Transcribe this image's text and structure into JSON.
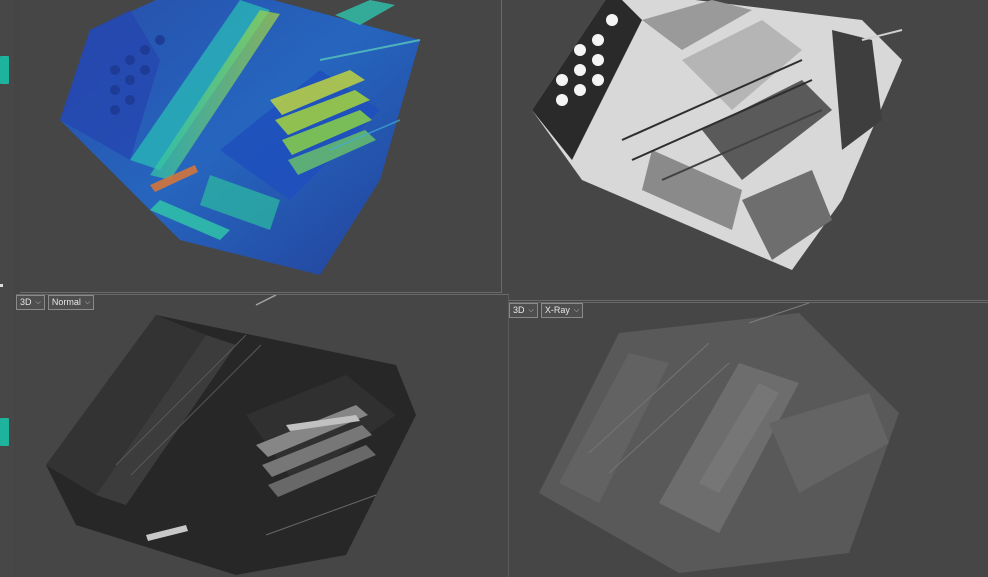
{
  "viewports": [
    {
      "id": "top-left",
      "render": "color-gradient"
    },
    {
      "id": "top-right",
      "render": "grayscale-shaded"
    },
    {
      "id": "bottom-left",
      "view_label": "3D",
      "mode_label": "Normal",
      "render": "dark-normal"
    },
    {
      "id": "bottom-right",
      "view_label": "3D",
      "mode_label": "X-Ray",
      "render": "xray"
    }
  ],
  "colors": {
    "accent": "#1db39c",
    "background": "#454545",
    "border": "#6a6a6a"
  }
}
